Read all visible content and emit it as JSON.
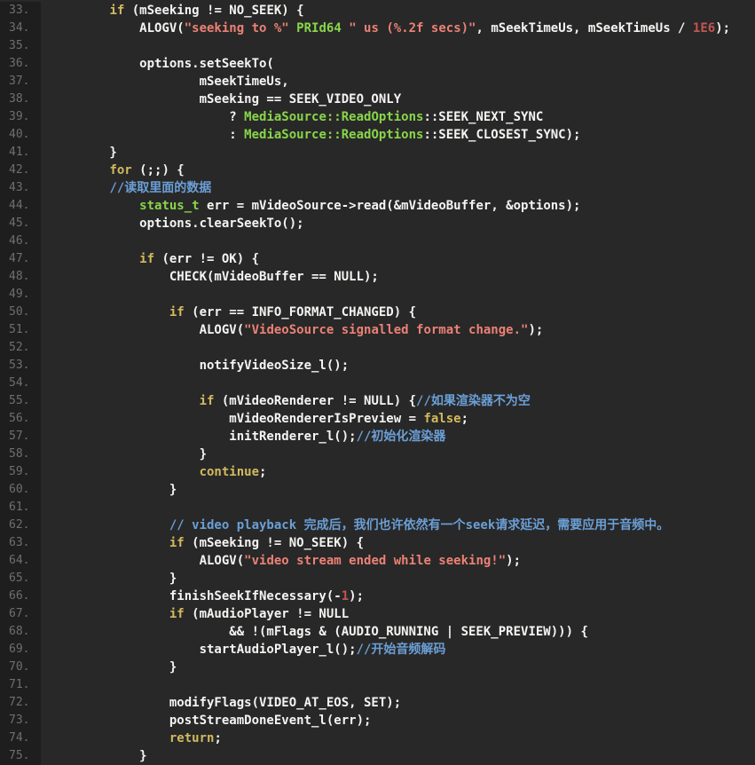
{
  "editor": {
    "description": "Dark-theme source code editor viewport showing C++ media player (AwesomePlayer) code with Chinese comments, lines 33-75",
    "palette": {
      "code_background": "#282828",
      "gutter_background": "#1e1e1e",
      "gutter_text": "#6f6f6f",
      "plain_text": "#f4f4f2",
      "keyword": "#d2ba5e",
      "string": "#ec8175",
      "number": "#c25551",
      "type_name": "#89d549",
      "comment": "#6b9fd6"
    },
    "first_line_number": 33,
    "last_line_number": 75,
    "lines": [
      {
        "num": "33.",
        "segments": [
          {
            "t": "        ",
            "c": "pl"
          },
          {
            "t": "if",
            "c": "kw"
          },
          {
            "t": " (mSeeking != NO_SEEK) {",
            "c": "pl"
          }
        ]
      },
      {
        "num": "34.",
        "segments": [
          {
            "t": "            ALOGV(",
            "c": "pl"
          },
          {
            "t": "\"seeking to %\"",
            "c": "st"
          },
          {
            "t": " ",
            "c": "pl"
          },
          {
            "t": "PRId64",
            "c": "ty"
          },
          {
            "t": " ",
            "c": "pl"
          },
          {
            "t": "\" us (%.2f secs)\"",
            "c": "st"
          },
          {
            "t": ", mSeekTimeUs, mSeekTimeUs / ",
            "c": "pl"
          },
          {
            "t": "1E6",
            "c": "nu"
          },
          {
            "t": ");",
            "c": "pl"
          }
        ]
      },
      {
        "num": "35.",
        "segments": []
      },
      {
        "num": "36.",
        "segments": [
          {
            "t": "            options.setSeekTo(",
            "c": "pl"
          }
        ]
      },
      {
        "num": "37.",
        "segments": [
          {
            "t": "                    mSeekTimeUs,",
            "c": "pl"
          }
        ]
      },
      {
        "num": "38.",
        "segments": [
          {
            "t": "                    mSeeking == SEEK_VIDEO_ONLY",
            "c": "pl"
          }
        ]
      },
      {
        "num": "39.",
        "segments": [
          {
            "t": "                        ? ",
            "c": "pl"
          },
          {
            "t": "MediaSource::ReadOptions",
            "c": "ty"
          },
          {
            "t": "::SEEK_NEXT_SYNC",
            "c": "pl"
          }
        ]
      },
      {
        "num": "40.",
        "segments": [
          {
            "t": "                        : ",
            "c": "pl"
          },
          {
            "t": "MediaSource::ReadOptions",
            "c": "ty"
          },
          {
            "t": "::SEEK_CLOSEST_SYNC);",
            "c": "pl"
          }
        ]
      },
      {
        "num": "41.",
        "segments": [
          {
            "t": "        }",
            "c": "pl"
          }
        ]
      },
      {
        "num": "42.",
        "segments": [
          {
            "t": "        ",
            "c": "pl"
          },
          {
            "t": "for",
            "c": "kw"
          },
          {
            "t": " (;;) {",
            "c": "pl"
          }
        ]
      },
      {
        "num": "43.",
        "segments": [
          {
            "t": "        ",
            "c": "pl"
          },
          {
            "t": "//读取里面的数据",
            "c": "co"
          }
        ]
      },
      {
        "num": "44.",
        "segments": [
          {
            "t": "            ",
            "c": "pl"
          },
          {
            "t": "status_t",
            "c": "ty"
          },
          {
            "t": " err = mVideoSource->read(&mVideoBuffer, &options);",
            "c": "pl"
          }
        ]
      },
      {
        "num": "45.",
        "segments": [
          {
            "t": "            options.clearSeekTo();",
            "c": "pl"
          }
        ]
      },
      {
        "num": "46.",
        "segments": []
      },
      {
        "num": "47.",
        "segments": [
          {
            "t": "            ",
            "c": "pl"
          },
          {
            "t": "if",
            "c": "kw"
          },
          {
            "t": " (err != OK) {",
            "c": "pl"
          }
        ]
      },
      {
        "num": "48.",
        "segments": [
          {
            "t": "                CHECK(mVideoBuffer == NULL);",
            "c": "pl"
          }
        ]
      },
      {
        "num": "49.",
        "segments": []
      },
      {
        "num": "50.",
        "segments": [
          {
            "t": "                ",
            "c": "pl"
          },
          {
            "t": "if",
            "c": "kw"
          },
          {
            "t": " (err == INFO_FORMAT_CHANGED) {",
            "c": "pl"
          }
        ]
      },
      {
        "num": "51.",
        "segments": [
          {
            "t": "                    ALOGV(",
            "c": "pl"
          },
          {
            "t": "\"VideoSource signalled format change.\"",
            "c": "st"
          },
          {
            "t": ");",
            "c": "pl"
          }
        ]
      },
      {
        "num": "52.",
        "segments": []
      },
      {
        "num": "53.",
        "segments": [
          {
            "t": "                    notifyVideoSize_l();",
            "c": "pl"
          }
        ]
      },
      {
        "num": "54.",
        "segments": []
      },
      {
        "num": "55.",
        "segments": [
          {
            "t": "                    ",
            "c": "pl"
          },
          {
            "t": "if",
            "c": "kw"
          },
          {
            "t": " (mVideoRenderer != NULL) {",
            "c": "pl"
          },
          {
            "t": "//如果渲染器不为空",
            "c": "co"
          }
        ]
      },
      {
        "num": "56.",
        "segments": [
          {
            "t": "                        mVideoRendererIsPreview = ",
            "c": "pl"
          },
          {
            "t": "false",
            "c": "kw"
          },
          {
            "t": ";",
            "c": "pl"
          }
        ]
      },
      {
        "num": "57.",
        "segments": [
          {
            "t": "                        initRenderer_l();",
            "c": "pl"
          },
          {
            "t": "//初始化渲染器",
            "c": "co"
          }
        ]
      },
      {
        "num": "58.",
        "segments": [
          {
            "t": "                    }",
            "c": "pl"
          }
        ]
      },
      {
        "num": "59.",
        "segments": [
          {
            "t": "                    ",
            "c": "pl"
          },
          {
            "t": "continue",
            "c": "kw"
          },
          {
            "t": ";",
            "c": "pl"
          }
        ]
      },
      {
        "num": "60.",
        "segments": [
          {
            "t": "                }",
            "c": "pl"
          }
        ]
      },
      {
        "num": "61.",
        "segments": []
      },
      {
        "num": "62.",
        "segments": [
          {
            "t": "                ",
            "c": "pl"
          },
          {
            "t": "// video playback 完成后，我们也许依然有一个seek请求延迟，需要应用于音频中。",
            "c": "co"
          }
        ]
      },
      {
        "num": "63.",
        "segments": [
          {
            "t": "                ",
            "c": "pl"
          },
          {
            "t": "if",
            "c": "kw"
          },
          {
            "t": " (mSeeking != NO_SEEK) {",
            "c": "pl"
          }
        ]
      },
      {
        "num": "64.",
        "segments": [
          {
            "t": "                    ALOGV(",
            "c": "pl"
          },
          {
            "t": "\"video stream ended while seeking!\"",
            "c": "st"
          },
          {
            "t": ");",
            "c": "pl"
          }
        ]
      },
      {
        "num": "65.",
        "segments": [
          {
            "t": "                }",
            "c": "pl"
          }
        ]
      },
      {
        "num": "66.",
        "segments": [
          {
            "t": "                finishSeekIfNecessary(-",
            "c": "pl"
          },
          {
            "t": "1",
            "c": "nu"
          },
          {
            "t": ");",
            "c": "pl"
          }
        ]
      },
      {
        "num": "67.",
        "segments": [
          {
            "t": "                ",
            "c": "pl"
          },
          {
            "t": "if",
            "c": "kw"
          },
          {
            "t": " (mAudioPlayer != NULL",
            "c": "pl"
          }
        ]
      },
      {
        "num": "68.",
        "segments": [
          {
            "t": "                        && !(mFlags & (AUDIO_RUNNING | SEEK_PREVIEW))) {",
            "c": "pl"
          }
        ]
      },
      {
        "num": "69.",
        "segments": [
          {
            "t": "                    startAudioPlayer_l();",
            "c": "pl"
          },
          {
            "t": "//开始音频解码",
            "c": "co"
          }
        ]
      },
      {
        "num": "70.",
        "segments": [
          {
            "t": "                }",
            "c": "pl"
          }
        ]
      },
      {
        "num": "71.",
        "segments": []
      },
      {
        "num": "72.",
        "segments": [
          {
            "t": "                modifyFlags(VIDEO_AT_EOS, SET);",
            "c": "pl"
          }
        ]
      },
      {
        "num": "73.",
        "segments": [
          {
            "t": "                postStreamDoneEvent_l(err);",
            "c": "pl"
          }
        ]
      },
      {
        "num": "74.",
        "segments": [
          {
            "t": "                ",
            "c": "pl"
          },
          {
            "t": "return",
            "c": "kw"
          },
          {
            "t": ";",
            "c": "pl"
          }
        ]
      },
      {
        "num": "75.",
        "segments": [
          {
            "t": "            }",
            "c": "pl"
          }
        ]
      }
    ]
  }
}
